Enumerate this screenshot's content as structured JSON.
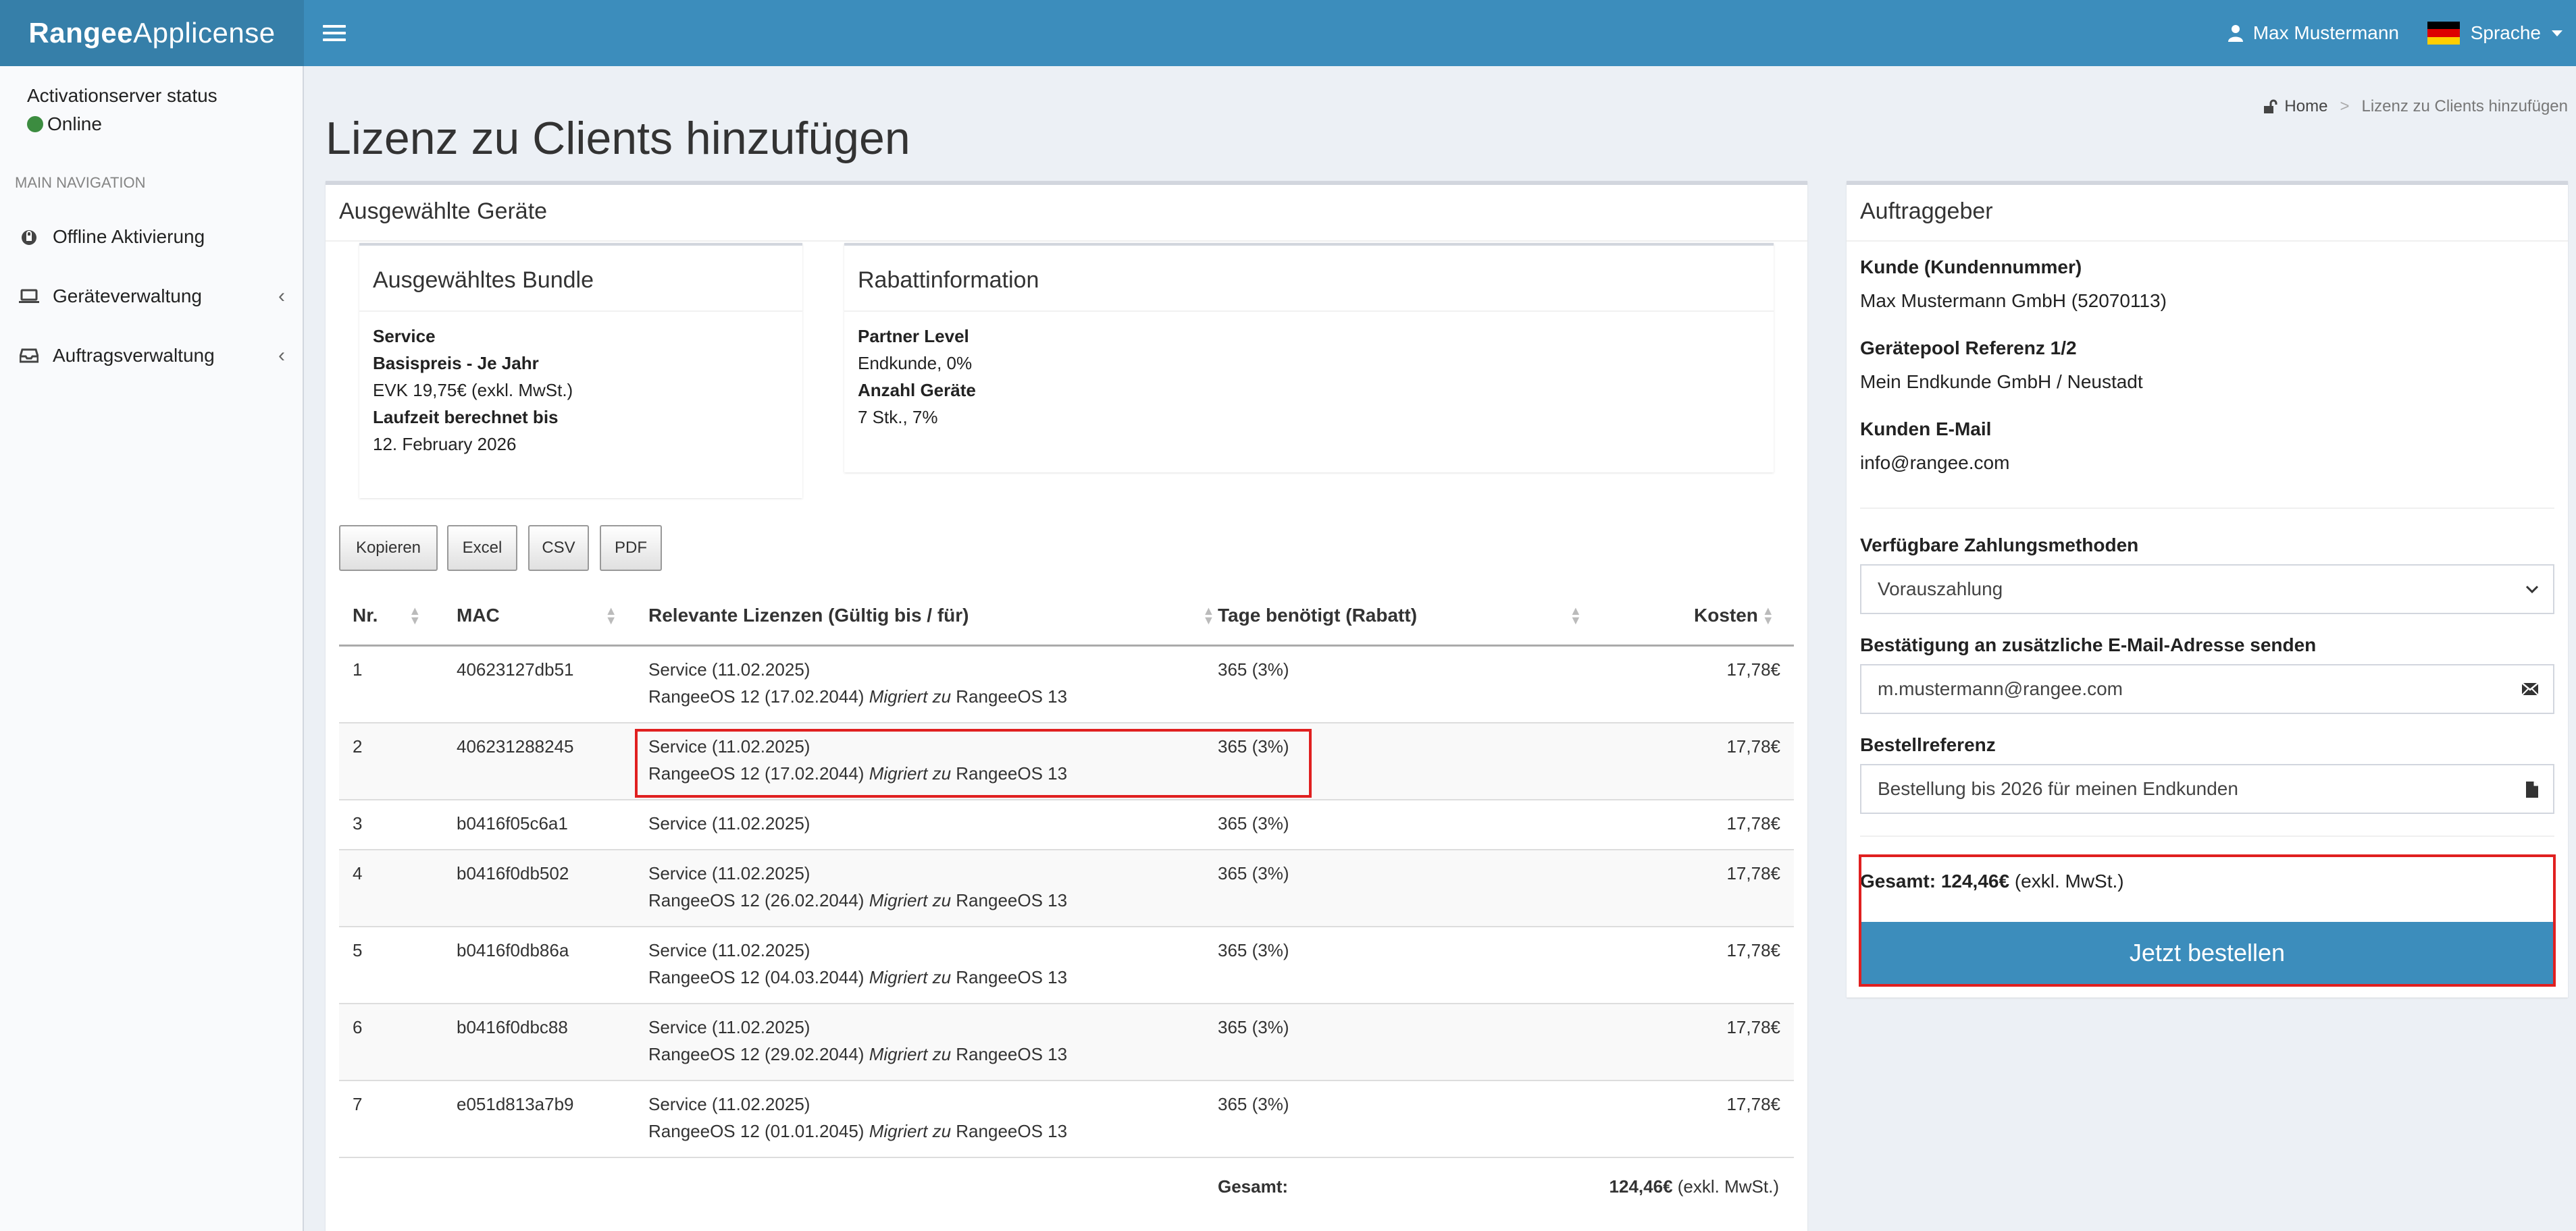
{
  "app": {
    "logo_bold": "Rangee",
    "logo_rest": "Applicense",
    "user_name": "Max Mustermann",
    "language_label": "Sprache"
  },
  "sidebar": {
    "status_title": "Activationserver status",
    "status_value": "Online",
    "nav_header": "MAIN NAVIGATION",
    "items": [
      {
        "label": "Offline Aktivierung",
        "icon": "lock-icon"
      },
      {
        "label": "Geräteverwaltung",
        "icon": "laptop-icon"
      },
      {
        "label": "Auftragsverwaltung",
        "icon": "inbox-icon"
      }
    ]
  },
  "page": {
    "title": "Lizenz zu Clients hinzufügen",
    "breadcrumb_home": "Home",
    "breadcrumb_current": "Lizenz zu Clients hinzufügen"
  },
  "devices_box": {
    "title": "Ausgewählte Geräte",
    "bundle": {
      "title": "Ausgewähltes Bundle",
      "name": "Service",
      "price_label": "Basispreis - Je Jahr",
      "price_value": "EVK 19,75€ (exkl. MwSt.)",
      "runtime_label": "Laufzeit berechnet bis",
      "runtime_value": "12. February 2026"
    },
    "discount": {
      "title": "Rabattinformation",
      "partner_label": "Partner Level",
      "partner_value": "Endkunde, 0%",
      "count_label": "Anzahl Geräte",
      "count_value": "7 Stk., 7%"
    },
    "buttons": [
      "Kopieren",
      "Excel",
      "CSV",
      "PDF"
    ],
    "table": {
      "headers": [
        "Nr.",
        "MAC",
        "Relevante Lizenzen (Gültig bis / für)",
        "Tage benötigt (Rabatt)",
        "Kosten"
      ],
      "rows": [
        {
          "nr": "1",
          "mac": "40623127db51",
          "lic1": "Service (11.02.2025)",
          "lic2_pre": "RangeeOS 12 (17.02.2044)",
          "lic2_mid": "Migriert zu",
          "lic2_post": "RangeeOS 13",
          "days": "365 (3%)",
          "cost": "17,78€"
        },
        {
          "nr": "2",
          "mac": "406231288245",
          "lic1": "Service (11.02.2025)",
          "lic2_pre": "RangeeOS 12 (17.02.2044)",
          "lic2_mid": "Migriert zu",
          "lic2_post": "RangeeOS 13",
          "days": "365 (3%)",
          "cost": "17,78€"
        },
        {
          "nr": "3",
          "mac": "b0416f05c6a1",
          "lic1": "Service (11.02.2025)",
          "lic2_pre": "",
          "lic2_mid": "",
          "lic2_post": "",
          "days": "365 (3%)",
          "cost": "17,78€"
        },
        {
          "nr": "4",
          "mac": "b0416f0db502",
          "lic1": "Service (11.02.2025)",
          "lic2_pre": "RangeeOS 12 (26.02.2044)",
          "lic2_mid": "Migriert zu",
          "lic2_post": "RangeeOS 13",
          "days": "365 (3%)",
          "cost": "17,78€"
        },
        {
          "nr": "5",
          "mac": "b0416f0db86a",
          "lic1": "Service (11.02.2025)",
          "lic2_pre": "RangeeOS 12 (04.03.2044)",
          "lic2_mid": "Migriert zu",
          "lic2_post": "RangeeOS 13",
          "days": "365 (3%)",
          "cost": "17,78€"
        },
        {
          "nr": "6",
          "mac": "b0416f0dbc88",
          "lic1": "Service (11.02.2025)",
          "lic2_pre": "RangeeOS 12 (29.02.2044)",
          "lic2_mid": "Migriert zu",
          "lic2_post": "RangeeOS 13",
          "days": "365 (3%)",
          "cost": "17,78€"
        },
        {
          "nr": "7",
          "mac": "e051d813a7b9",
          "lic1": "Service (11.02.2025)",
          "lic2_pre": "RangeeOS 12 (01.01.2045)",
          "lic2_mid": "Migriert zu",
          "lic2_post": "RangeeOS 13",
          "days": "365 (3%)",
          "cost": "17,78€"
        }
      ],
      "footer_label": "Gesamt:",
      "footer_value": "124,46€",
      "footer_note": "(exkl. MwSt.)"
    }
  },
  "client_box": {
    "title": "Auftraggeber",
    "customer_label": "Kunde (Kundennummer)",
    "customer_value": "Max Mustermann GmbH (52070113)",
    "pool_label": "Gerätepool Referenz 1/2",
    "pool_value": "Mein Endkunde GmbH / Neustadt",
    "email_label": "Kunden E-Mail",
    "email_value": "info@rangee.com",
    "payment_label": "Verfügbare Zahlungsmethoden",
    "payment_value": "Vorauszahlung",
    "confirm_label": "Bestätigung an zusätzliche E-Mail-Adresse senden",
    "confirm_value": "m.mustermann@rangee.com",
    "ref_label": "Bestellreferenz",
    "ref_value": "Bestellung bis 2026 für meinen Endkunden",
    "total_label": "Gesamt: 124,46€",
    "total_note": "(exkl. MwSt.)",
    "order_button": "Jetzt bestellen"
  },
  "colors": {
    "header": "#3c8dbc",
    "logo_bg": "#367fa9",
    "online": "#3c8c40",
    "highlight": "#e02020"
  }
}
